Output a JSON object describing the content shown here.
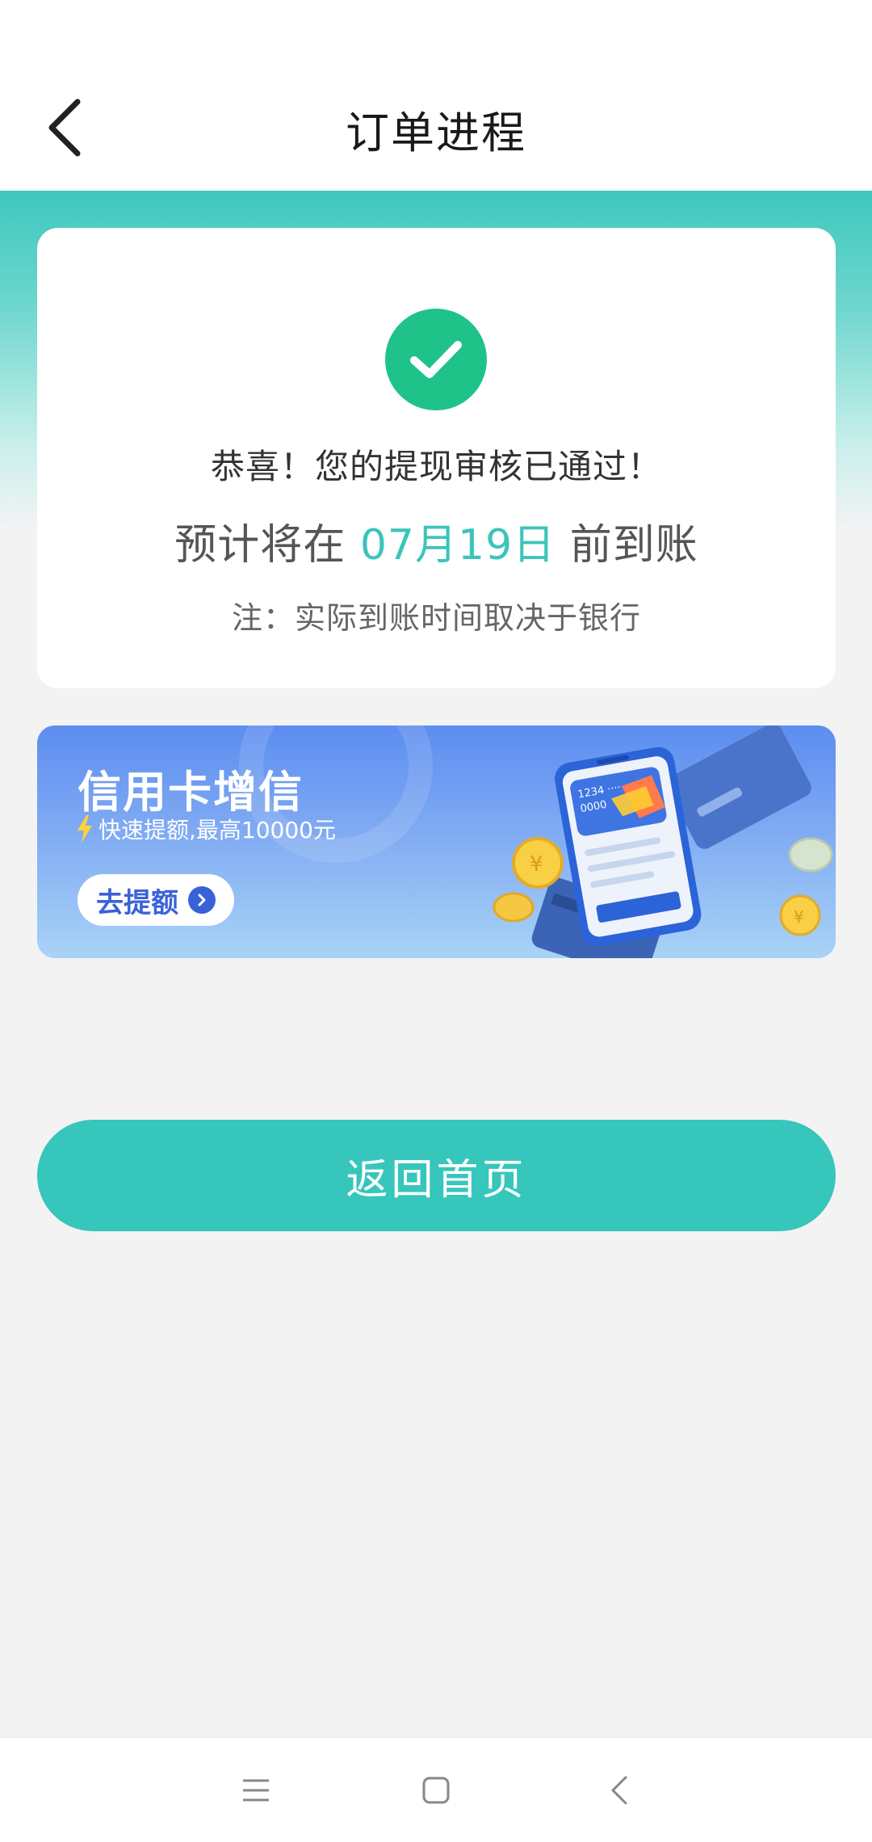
{
  "header": {
    "title": "订单进程"
  },
  "result": {
    "congrats": "恭喜！您的提现审核已通过！",
    "arrival_prefix": "预计将在",
    "arrival_date": "07月19日",
    "arrival_suffix": "前到账",
    "note": "注：实际到账时间取决于银行"
  },
  "promo": {
    "title": "信用卡增信",
    "subtitle": "快速提额,最高10000元",
    "button_label": "去提额",
    "card_number_line1": "1234 ····",
    "card_number_line2": "0000"
  },
  "actions": {
    "home_label": "返回首页"
  },
  "colors": {
    "accent": "#36c6bb",
    "success": "#1fc38a",
    "promo_blue": "#5c8df0"
  },
  "icons": {
    "back": "back-arrow-icon",
    "check": "check-icon",
    "lightning": "lightning-icon",
    "nav_menu": "menu-icon",
    "nav_home": "home-square-icon",
    "nav_back": "nav-back-icon"
  }
}
